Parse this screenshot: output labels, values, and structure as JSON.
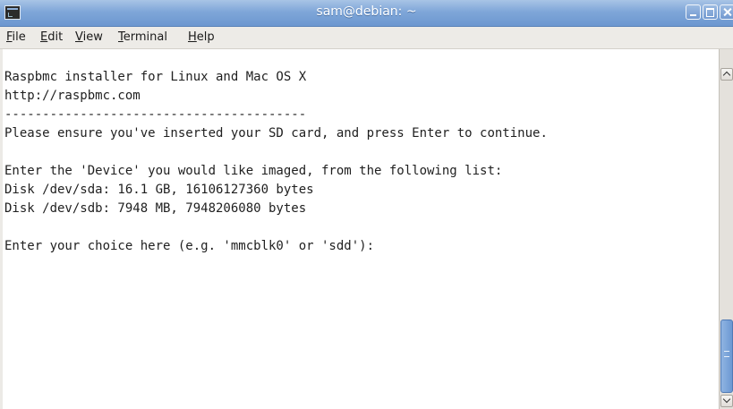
{
  "window": {
    "title": "sam@debian: ~",
    "title_icon": "terminal-icon"
  },
  "colors": {
    "titlebar": "#7fa6d8",
    "terminal_background": "#ffffff",
    "terminal_text": "#1f1f1f",
    "menubar": "#edebe7",
    "scroll_thumb": "#6c98d2"
  },
  "menu": {
    "items": [
      {
        "label": "File",
        "mnemonic": "F",
        "rest": "ile"
      },
      {
        "label": "Edit",
        "mnemonic": "E",
        "rest": "dit"
      },
      {
        "label": "View",
        "mnemonic": "V",
        "rest": "iew"
      },
      {
        "label": "Terminal",
        "mnemonic": "T",
        "rest": "erminal"
      },
      {
        "label": "Help",
        "mnemonic": "H",
        "rest": "elp"
      }
    ]
  },
  "terminal": {
    "lines": [
      "Raspbmc installer for Linux and Mac OS X",
      "http://raspbmc.com",
      "----------------------------------------",
      "Please ensure you've inserted your SD card, and press Enter to continue.",
      "",
      "Enter the 'Device' you would like imaged, from the following list:",
      "Disk /dev/sda: 16.1 GB, 16106127360 bytes",
      "Disk /dev/sdb: 7948 MB, 7948206080 bytes",
      "",
      "Enter your choice here (e.g. 'mmcblk0' or 'sdd'):"
    ]
  }
}
